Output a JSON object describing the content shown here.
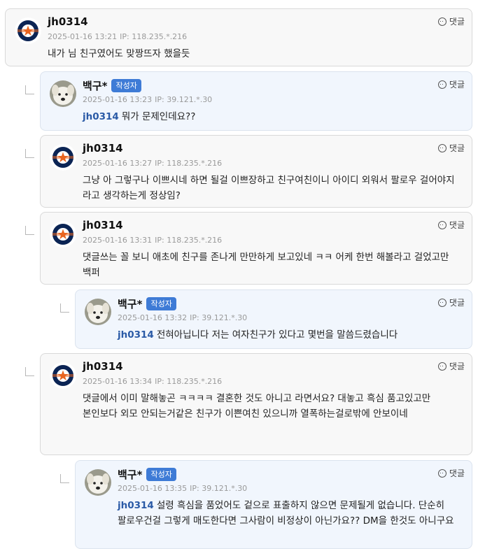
{
  "reply_label": "댓글",
  "author_badge": "작성자",
  "comments": [
    {
      "name": "jh0314",
      "date": "2025-01-16 13:21",
      "ip": "IP: 118.235.*.216",
      "mention": "",
      "text": "내가 님 친구였어도 맞짱뜨자 했을듯",
      "avatar": "astros-logo",
      "is_author": false
    },
    {
      "name": "백구*",
      "date": "2025-01-16 13:23",
      "ip": "IP: 39.121.*.30",
      "mention": "jh0314",
      "text": "뭐가 문제인데요??",
      "avatar": "dog-photo",
      "is_author": true
    },
    {
      "name": "jh0314",
      "date": "2025-01-16 13:27",
      "ip": "IP: 118.235.*.216",
      "mention": "",
      "text": "그냥 아 그렇구나 이쁘시네 하면 될걸 이쁘장하고 친구여친이니 아이디 외워서 팔로우 걸어야지 라고 생각하는게 정상임?",
      "avatar": "astros-logo",
      "is_author": false
    },
    {
      "name": "jh0314",
      "date": "2025-01-16 13:31",
      "ip": "IP: 118.235.*.216",
      "mention": "",
      "text": "댓글쓰는 꼴 보니 애초에 친구를 존나게 만만하게 보고있네 ㅋㅋ 어케 한번 해볼라고 걸었고만 백퍼",
      "avatar": "astros-logo",
      "is_author": false
    },
    {
      "name": "백구*",
      "date": "2025-01-16 13:32",
      "ip": "IP: 39.121.*.30",
      "mention": "jh0314",
      "text": "전혀아닙니다 저는 여자친구가 있다고 몇번을 말씀드렸습니다",
      "avatar": "dog-photo",
      "is_author": true
    },
    {
      "name": "jh0314",
      "date": "2025-01-16 13:34",
      "ip": "IP: 118.235.*.216",
      "mention": "",
      "text": "댓글에서 이미 말해놓곤 ㅋㅋㅋㅋ 결혼한 것도 아니고 라면서요? 대놓고 흑심 품고있고만\n본인보다 외모 안되는거같은 친구가 이쁜여친 있으니까 열폭하는걸로밖에 안보이네",
      "avatar": "astros-logo",
      "is_author": false
    },
    {
      "name": "백구*",
      "date": "2025-01-16 13:35",
      "ip": "IP: 39.121.*.30",
      "mention": "jh0314",
      "text": "설령 흑심을 품었어도 겉으로 표출하지 않으면 문제될게 없습니다. 단순히 팔로우건걸 그렇게 매도한다면 그사람이 비정상이 아닌가요?? DM을 한것도 아니구요",
      "avatar": "dog-photo",
      "is_author": true
    }
  ]
}
